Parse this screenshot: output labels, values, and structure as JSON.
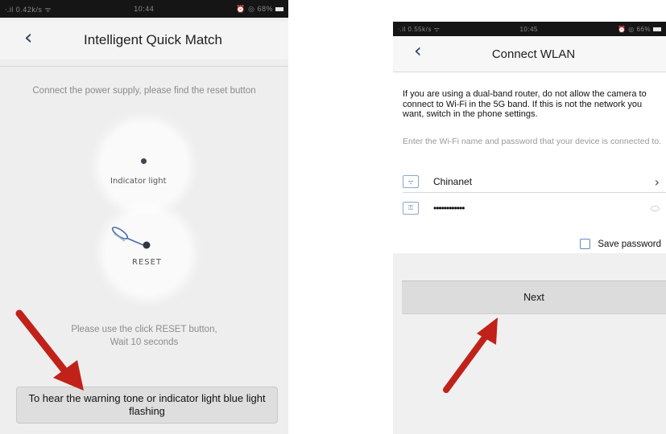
{
  "left_screen": {
    "status_bar": {
      "left": "ᐧ.il 0.42k/s ᯤ",
      "time": "10:44",
      "right": "⏰ ◎ 68%"
    },
    "title": "Intelligent Quick Match",
    "hint": "Connect the power supply, please find the reset button",
    "indicator_label": "Indicator light",
    "reset_label": "RESET",
    "instructions": [
      "Please use the click RESET button,",
      "Wait 10 seconds"
    ],
    "action_button": "To hear the warning tone or indicator light blue light flashing"
  },
  "right_screen": {
    "status_bar": {
      "left": "ᐧ.il 0.55k/s ᯤ",
      "time": "10:45",
      "right": "⏰ ◎ 66%"
    },
    "title": "Connect WLAN",
    "notice": "If you are using a dual-band router, do not allow the camera to connect to Wi-Fi in the 5G band. If this is not the network you want, switch in the phone settings.",
    "subnotice": "Enter the Wi-Fi name and password that your device is connected to.",
    "wifi_name": "Chinanet",
    "password_mask": "••••••••••••",
    "save_password_label": "Save password",
    "next_button": "Next"
  },
  "colors": {
    "arrow": "#c0221a",
    "status_bar": "#151515",
    "button_bg": "#dedede"
  },
  "icons": [
    "back-chevron-icon",
    "wifi-icon",
    "lock-icon",
    "chevron-right-icon",
    "eye-icon",
    "checkbox-icon",
    "arrow-annotation"
  ]
}
